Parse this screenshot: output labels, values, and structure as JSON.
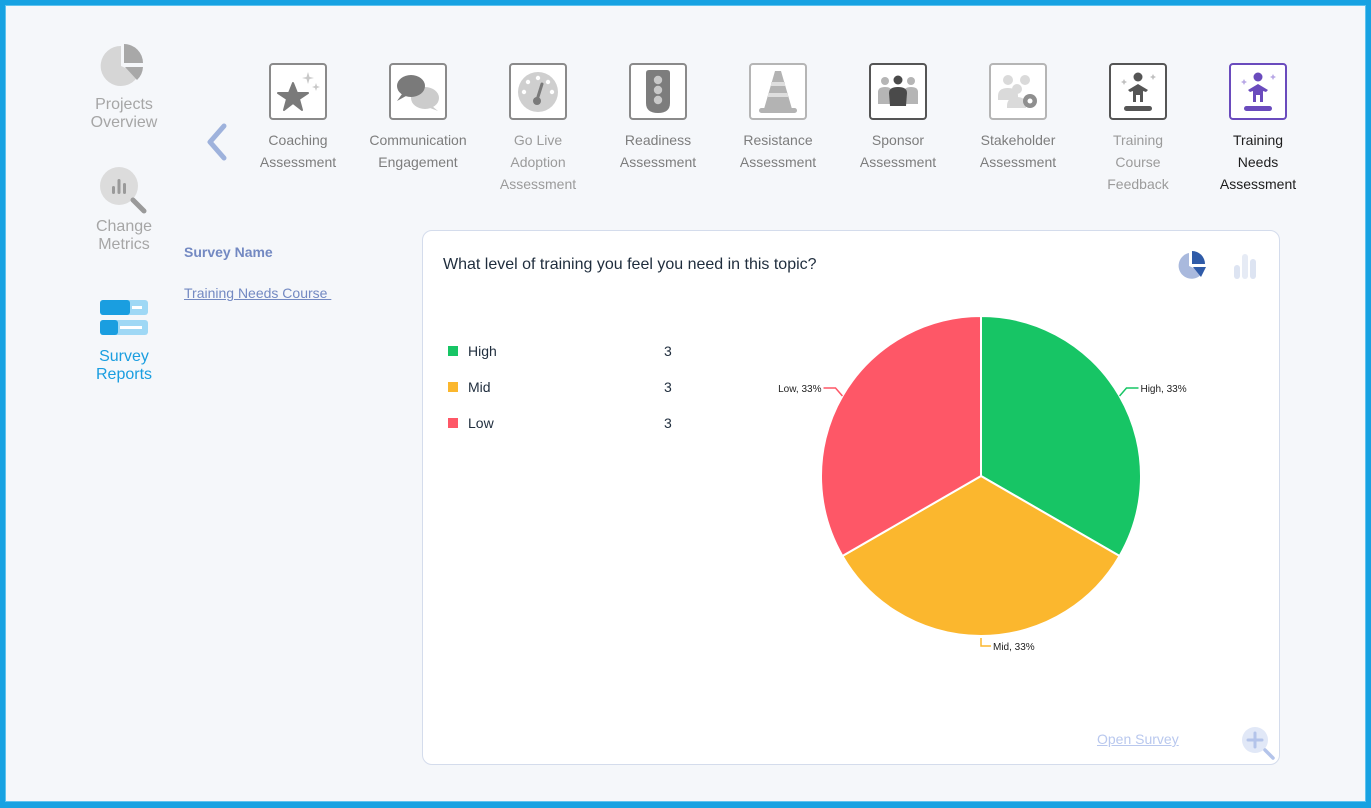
{
  "nav": {
    "items": [
      {
        "label_1": "Projects",
        "label_2": "Overview",
        "icon": "pie-chart-icon",
        "active": false
      },
      {
        "label_1": "Change",
        "label_2": "Metrics",
        "icon": "magnify-chart-icon",
        "active": false
      },
      {
        "label_1": "Survey",
        "label_2": "Reports",
        "icon": "survey-reports-icon",
        "active": true
      }
    ]
  },
  "back": {
    "icon": "chevron-left-icon"
  },
  "tiles": [
    {
      "lines": [
        "Coaching",
        "Assessment"
      ],
      "icon": "star-sparkle-icon"
    },
    {
      "lines": [
        "Communication",
        "Engagement"
      ],
      "icon": "chat-bubbles-icon"
    },
    {
      "lines": [
        "Go Live",
        "Adoption",
        "Assessment"
      ],
      "icon": "gauge-icon"
    },
    {
      "lines": [
        "Readiness",
        "Assessment"
      ],
      "icon": "traffic-light-icon"
    },
    {
      "lines": [
        "Resistance",
        "Assessment"
      ],
      "icon": "traffic-cone-icon"
    },
    {
      "lines": [
        "Sponsor",
        "Assessment"
      ],
      "icon": "people-group-icon"
    },
    {
      "lines": [
        "Stakeholder",
        "Assessment"
      ],
      "icon": "people-gear-icon"
    },
    {
      "lines": [
        "Training",
        "Course",
        "Feedback"
      ],
      "icon": "person-podium-icon"
    },
    {
      "lines": [
        "Training",
        "Needs",
        "Assessment"
      ],
      "icon": "person-podium-icon",
      "active": true
    }
  ],
  "survey": {
    "heading": "Survey Name",
    "name": "Training Needs Course "
  },
  "card": {
    "question": "What level of training you feel you need in this topic?",
    "open_label": "Open Survey"
  },
  "colors": {
    "high": "#17c565",
    "mid": "#fbb72e",
    "low": "#fe5767",
    "accent": "#1a9ee0",
    "active_tile": "#6a4bbd"
  },
  "chart_data": {
    "type": "pie",
    "title": "What level of training you feel you need in this topic?",
    "slices": [
      {
        "label": "High",
        "value": 3,
        "percent": 33,
        "color": "#17c565",
        "data_label": "High, 33%"
      },
      {
        "label": "Mid",
        "value": 3,
        "percent": 33,
        "color": "#fbb72e",
        "data_label": "Mid, 33%"
      },
      {
        "label": "Low",
        "value": 3,
        "percent": 33,
        "color": "#fe5767",
        "data_label": "Low, 33%"
      }
    ],
    "legend": "left"
  }
}
